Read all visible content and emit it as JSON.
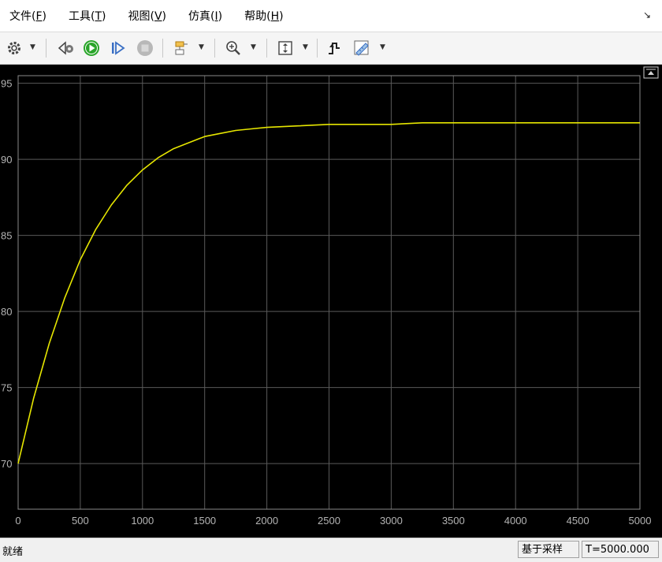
{
  "menu": {
    "file": {
      "label": "文件(",
      "key": "F",
      "close": ")"
    },
    "tools": {
      "label": "工具(",
      "key": "T",
      "close": ")"
    },
    "view": {
      "label": "视图(",
      "key": "V",
      "close": ")"
    },
    "simulation": {
      "label": "仿真(",
      "key": "I",
      "close": ")"
    },
    "help": {
      "label": "帮助(",
      "key": "H",
      "close": ")"
    }
  },
  "toolbar_icons": [
    "gear-icon",
    "step-back-icon",
    "run-icon",
    "step-forward-icon",
    "stop-icon",
    "highlight-block-icon",
    "zoom-in-icon",
    "autoscale-icon",
    "triggers-icon",
    "measurements-icon"
  ],
  "colors": {
    "background": "#000000",
    "grid": "#5a5a5a",
    "axis_text": "#b4b4b4",
    "signal": "#e6e600"
  },
  "chart_data": {
    "type": "line",
    "title": "",
    "xlabel": "",
    "ylabel": "",
    "xlim": [
      0,
      5000
    ],
    "ylim": [
      67,
      95.5
    ],
    "xticks": [
      0,
      500,
      1000,
      1500,
      2000,
      2500,
      3000,
      3500,
      4000,
      4500,
      5000
    ],
    "yticks": [
      70,
      75,
      80,
      85,
      90,
      95
    ],
    "grid": true,
    "series": [
      {
        "color": "#e6e600",
        "x": [
          0,
          125,
          250,
          375,
          500,
          625,
          750,
          875,
          1000,
          1125,
          1250,
          1375,
          1500,
          1625,
          1750,
          1875,
          2000,
          2250,
          2500,
          2750,
          3000,
          3250,
          3500,
          3750,
          4000,
          4250,
          4500,
          4750,
          5000
        ],
        "y": [
          70.0,
          74.3,
          77.9,
          80.9,
          83.4,
          85.4,
          87.0,
          88.3,
          89.3,
          90.1,
          90.7,
          91.1,
          91.5,
          91.7,
          91.9,
          92.0,
          92.1,
          92.2,
          92.3,
          92.3,
          92.3,
          92.4,
          92.4,
          92.4,
          92.4,
          92.4,
          92.4,
          92.4,
          92.4
        ]
      }
    ]
  },
  "status": {
    "ready": "就绪",
    "mode": "基于采样",
    "time": "T=5000.000"
  }
}
